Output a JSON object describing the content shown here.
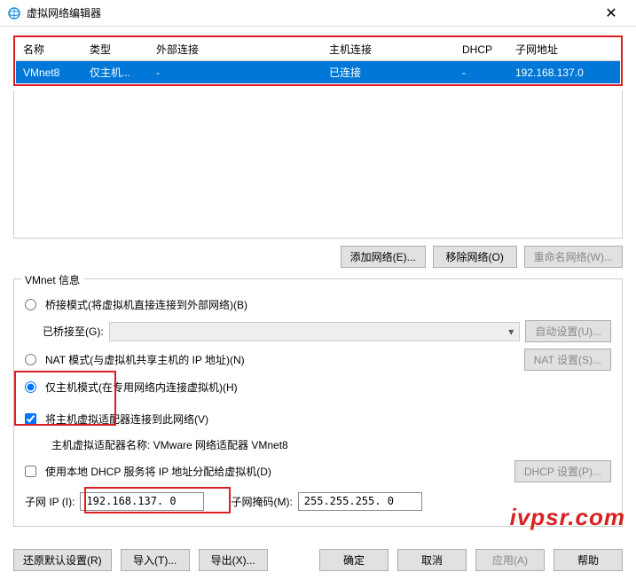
{
  "window": {
    "title": "虚拟网络编辑器"
  },
  "table": {
    "headers": {
      "name": "名称",
      "type": "类型",
      "external": "外部连接",
      "host": "主机连接",
      "dhcp": "DHCP",
      "subnet": "子网地址"
    },
    "row": {
      "name": "VMnet8",
      "type": "仅主机...",
      "external": "-",
      "host": "已连接",
      "dhcp": "-",
      "subnet": "192.168.137.0"
    }
  },
  "buttons": {
    "add": "添加网络(E)...",
    "remove": "移除网络(O)",
    "rename": "重命名网络(W)...",
    "auto": "自动设置(U)...",
    "nat": "NAT 设置(S)...",
    "dhcp": "DHCP 设置(P)...",
    "restore": "还原默认设置(R)",
    "import": "导入(T)...",
    "export": "导出(X)...",
    "ok": "确定",
    "cancel": "取消",
    "apply": "应用(A)",
    "help": "帮助"
  },
  "vmnet": {
    "legend": "VMnet 信息",
    "bridge_label": "桥接模式(将虚拟机直接连接到外部网络)(B)",
    "bridge_to": "已桥接至(G):",
    "nat_label": "NAT 模式(与虚拟机共享主机的 IP 地址)(N)",
    "hostonly_label": "仅主机模式(在专用网络内连接虚拟机)(H)",
    "hostadapter_label": "将主机虚拟适配器连接到此网络(V)",
    "hostadapter_name": "主机虚拟适配器名称: VMware 网络适配器 VMnet8",
    "dhcp_label": "使用本地 DHCP 服务将 IP 地址分配给虚拟机(D)",
    "subnet_ip_label": "子网 IP (I):",
    "subnet_ip": "192.168.137. 0",
    "mask_label": "子网掩码(M):",
    "mask": "255.255.255. 0"
  },
  "watermark": "ivpsr.com"
}
